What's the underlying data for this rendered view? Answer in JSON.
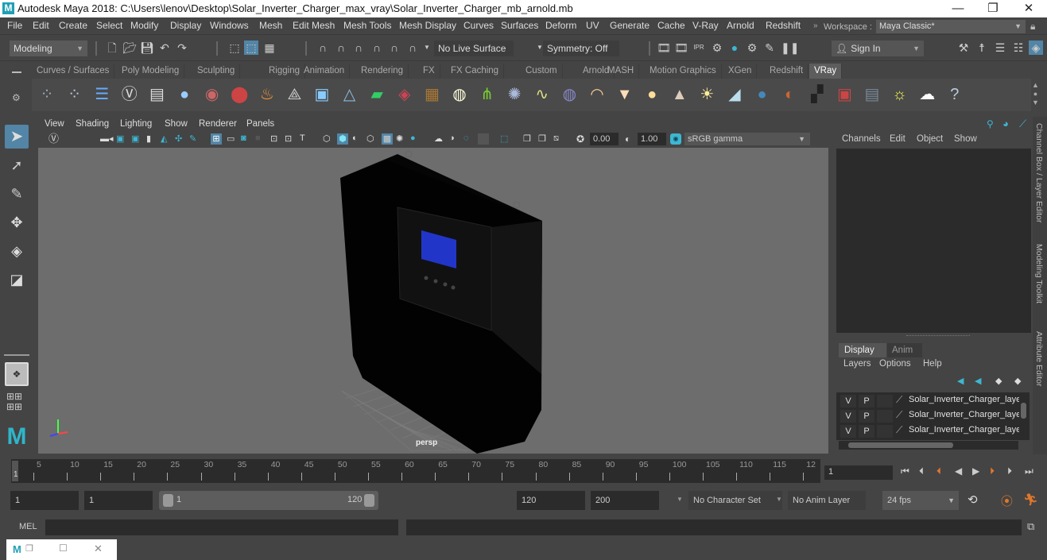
{
  "window": {
    "title": "Autodesk Maya 2018: C:\\Users\\lenov\\Desktop\\Solar_Inverter_Charger_max_vray\\Solar_Inverter_Charger_mb_arnold.mb",
    "logo": "M",
    "controls": {
      "minimize": "—",
      "restore": "❐",
      "close": "✕"
    }
  },
  "menubar": {
    "items": [
      "File",
      "Edit",
      "Create",
      "Select",
      "Modify",
      "Display",
      "Windows",
      "Mesh",
      "Edit Mesh",
      "Mesh Tools",
      "Mesh Display",
      "Curves",
      "Surfaces",
      "Deform",
      "UV",
      "Generate",
      "Cache",
      "V-Ray",
      "Arnold",
      "Redshift"
    ],
    "workspace_label": "Workspace :",
    "workspace_value": "Maya Classic*"
  },
  "statusline": {
    "menuset": "Modeling",
    "live_surface": "No Live Surface",
    "symmetry": "Symmetry: Off",
    "sign_in": "Sign In"
  },
  "shelf": {
    "tabs": [
      "Curves / Surfaces",
      "Poly Modeling",
      "Sculpting",
      "Rigging",
      "Animation",
      "Rendering",
      "FX",
      "FX Caching",
      "Custom",
      "Arnold",
      "MASH",
      "Motion Graphics",
      "XGen",
      "Redshift",
      "VRay"
    ],
    "active_tab": "VRay",
    "icons": [
      "vray-save-icon",
      "vray-load-icon",
      "vray-list-icon",
      "vray-logo-icon",
      "vray-doc-icon",
      "vray-sphere-stand-icon",
      "vray-camera-icon",
      "vray-molecule-icon",
      "vray-fire-icon",
      "vray-proxy-icon",
      "vray-light-box-icon",
      "vray-cone-sphere-icon",
      "vray-light-plane-icon",
      "vray-fur-icon",
      "vray-texture-icon",
      "vray-sphere-grid-icon",
      "vray-grass-icon",
      "vray-flake-icon",
      "vray-curve-icon",
      "vray-globe-icon",
      "vray-dome-light-icon",
      "vray-spot-light-icon",
      "vray-sphere-light-icon",
      "vray-ies-light-icon",
      "vray-sun-icon",
      "vray-plane-icon",
      "vray-material-icon",
      "vray-blend-material-icon",
      "vray-checker-icon",
      "vray-frame-buffer-icon",
      "vray-settings-icon",
      "vray-light-lister-icon",
      "vray-cloud-icon",
      "vray-help-icon"
    ]
  },
  "viewport": {
    "menu": [
      "View",
      "Shading",
      "Lighting",
      "Show",
      "Renderer",
      "Panels"
    ],
    "exposure": "0.00",
    "gamma": "1.00",
    "color_space": "sRGB gamma",
    "camera_label": "persp"
  },
  "channel_box": {
    "menu": [
      "Channels",
      "Edit",
      "Object",
      "Show"
    ]
  },
  "layer_editor": {
    "tabs": [
      "Display",
      "Anim"
    ],
    "active_tab": "Display",
    "menu": [
      "Layers",
      "Options",
      "Help"
    ],
    "layers": [
      {
        "v": "V",
        "p": "P",
        "name": "Solar_Inverter_Charger_layer"
      },
      {
        "v": "V",
        "p": "P",
        "name": "Solar_Inverter_Charger_layer"
      },
      {
        "v": "V",
        "p": "P",
        "name": "Solar_Inverter_Charger_layer"
      }
    ]
  },
  "side_tabs": [
    "Channel Box / Layer Editor",
    "Modeling Toolkit",
    "Attribute Editor"
  ],
  "timeline": {
    "ticks": [
      "5",
      "10",
      "15",
      "20",
      "25",
      "30",
      "35",
      "40",
      "45",
      "50",
      "55",
      "60",
      "65",
      "70",
      "75",
      "80",
      "85",
      "90",
      "95",
      "100",
      "105",
      "110",
      "115",
      "12"
    ],
    "current_frame_marker": "1",
    "current_frame": "1"
  },
  "range": {
    "start": "1",
    "playback_start": "1",
    "slider_start": "1",
    "slider_end": "120",
    "playback_end": "120",
    "end": "200",
    "character_set": "No Character Set",
    "anim_layer": "No Anim Layer",
    "fps": "24 fps"
  },
  "command_line": {
    "label": "MEL",
    "value": ""
  }
}
